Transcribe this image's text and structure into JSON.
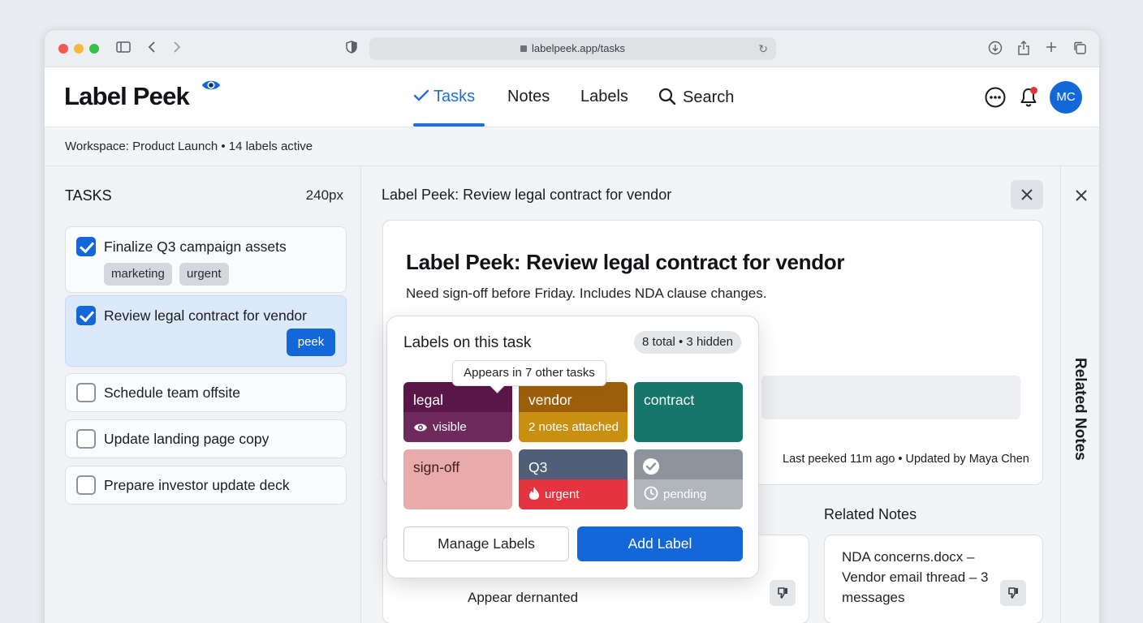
{
  "browser": {
    "url": "labelpeek.app/tasks"
  },
  "app": {
    "logo": "Label Peek",
    "nav": [
      {
        "label": "Tasks"
      },
      {
        "label": "Notes"
      },
      {
        "label": "Labels"
      },
      {
        "label": "Search"
      }
    ],
    "avatar_initials": "MC"
  },
  "workspace": {
    "summary": "Workspace: Product Launch • 14 labels active"
  },
  "sidebar": {
    "title": "TASKS",
    "width_label": "240px",
    "tasks": [
      {
        "label": "Finalize Q3 campaign assets",
        "checked": true,
        "tags": [
          "marketing",
          "urgent"
        ]
      },
      {
        "label": "Review legal contract for vendor",
        "checked": true,
        "selected": true,
        "action": "peek"
      },
      {
        "label": "Schedule team offsite",
        "checked": false
      },
      {
        "label": "Update landing page copy",
        "checked": false
      },
      {
        "label": "Prepare investor update deck",
        "checked": false
      }
    ]
  },
  "main": {
    "header_title": "Label Peek: Review legal contract for vendor",
    "card": {
      "title": "Label Peek: Review legal contract for vendor",
      "description": "Need sign-off before Friday. Includes NDA clause changes.",
      "meta": "Last peeked 11m ago • Updated by Maya Chen"
    },
    "related_notes_heading": "Related Notes",
    "left_note": {
      "text": "Appear dernanted"
    },
    "right_note": {
      "text": "NDA concerns.docx – Vendor email thread – 3 messages"
    }
  },
  "rail": {
    "label": "Related Notes"
  },
  "popover": {
    "title": "Labels on this task",
    "count": "8 total • 3 hidden",
    "tooltip": "Appears in 7 other tasks",
    "labels": [
      {
        "name": "legal",
        "sub": "visible",
        "sub_icon": "eye-icon",
        "color": "#5a1648",
        "sub_color": "#6e2a5c"
      },
      {
        "name": "vendor",
        "sub": "2 notes attached",
        "color": "#9c5f09",
        "sub_color": "#c98f0f"
      },
      {
        "name": "contract",
        "sub": "",
        "color": "#147769"
      },
      {
        "name": "sign-off",
        "sub": "",
        "color": "#e9aaab"
      },
      {
        "name": "Q3",
        "sub": "urgent",
        "sub_icon": "flame-icon",
        "color": "#505e78",
        "sub_color": "#e3343f"
      },
      {
        "name": "",
        "sub": "pending",
        "sub_icon": "clock-icon",
        "top_icon": "check-circle-icon",
        "color": "#8e949d",
        "sub_color": "#b1b6bd"
      }
    ],
    "manage_label": "Manage Labels",
    "add_label": "Add Label"
  }
}
